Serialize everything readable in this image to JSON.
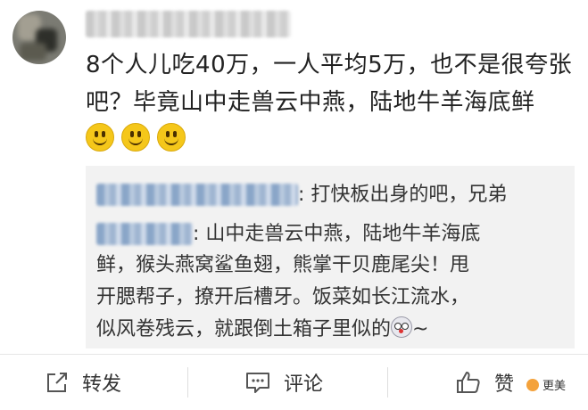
{
  "post": {
    "author": "",
    "content_text": "8个人儿吃40万，一人平均5万，也不是很夸张吧？毕竟山中走兽云中燕，陆地牛羊海底鲜",
    "emoji": [
      "smile-emoji",
      "smile-emoji",
      "smile-emoji"
    ]
  },
  "quote": {
    "reply1": {
      "author": "",
      "colon": ":",
      "text": " 打快板出身的吧，兄弟"
    },
    "reply2": {
      "author": "",
      "colon": ":",
      "line1": " 山中走兽云中燕，陆地牛羊海底",
      "line2": "鲜，猴头燕窝鲨鱼翅，熊掌干贝鹿尾尖！甩",
      "line3": "开腮帮子，撩开后槽牙。饭菜如长江流水，",
      "line4": "似风卷残云，就跟倒土箱子里似的",
      "tail": "~"
    }
  },
  "toolbar": {
    "forward": "转发",
    "comment": "评论",
    "like": "赞"
  },
  "watermark": {
    "text": "更美"
  }
}
